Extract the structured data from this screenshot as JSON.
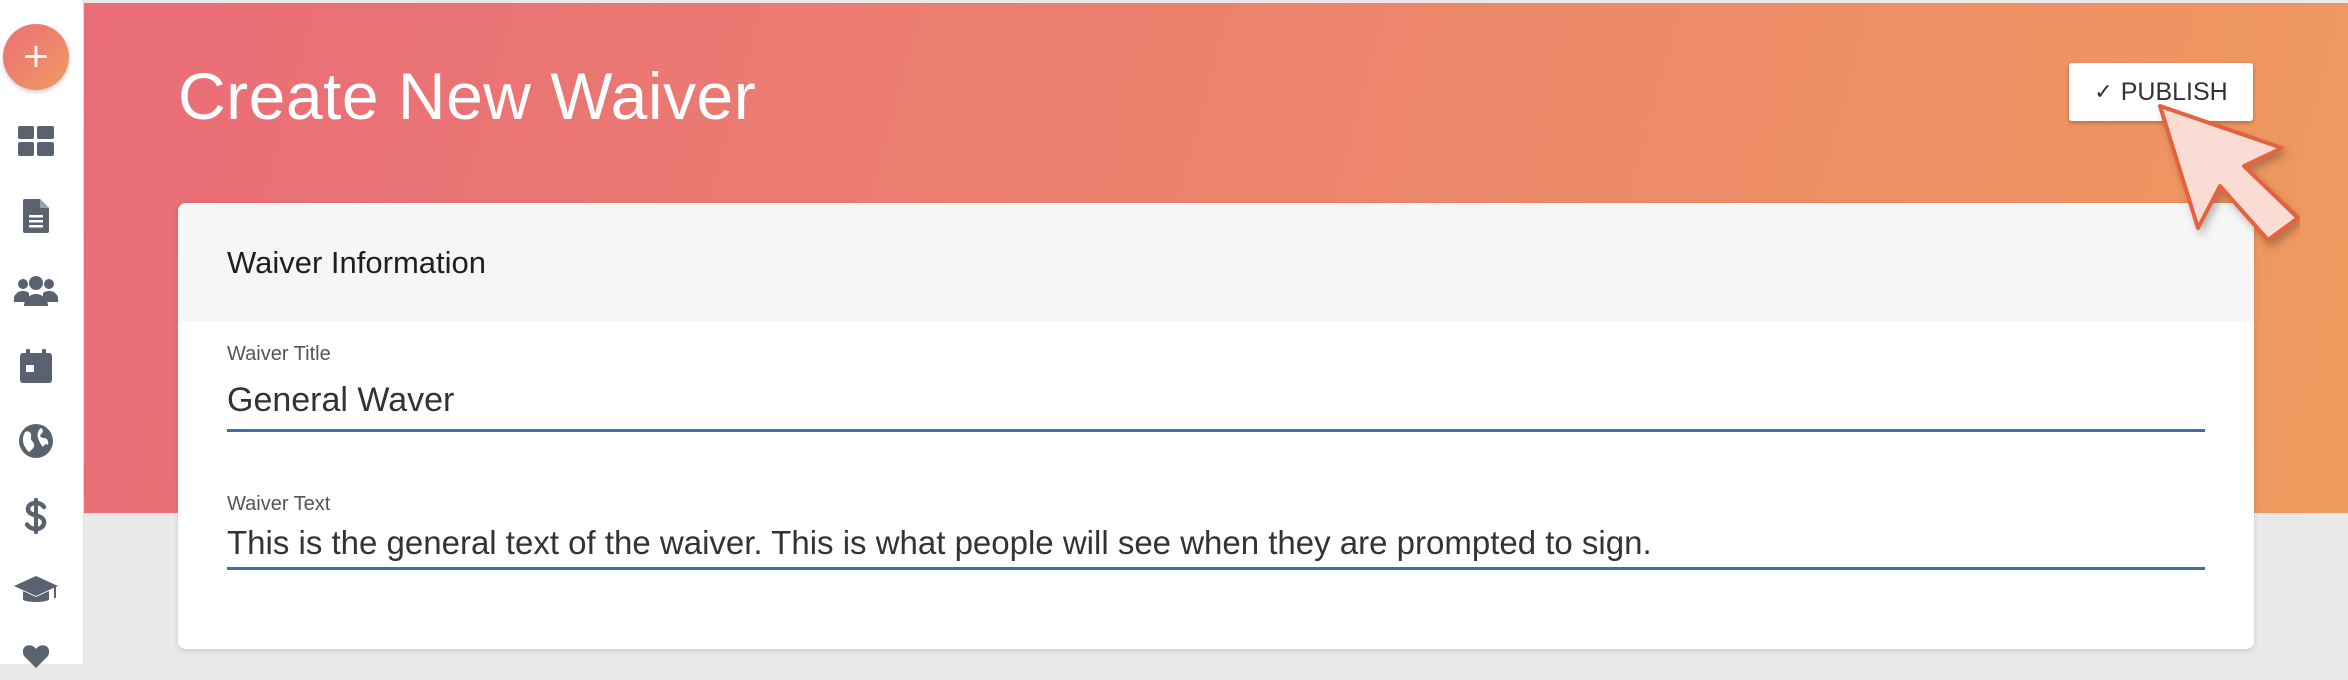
{
  "app": {
    "fab_label": "+",
    "accent_gradient": [
      "#eb6e78",
      "#ef9a60"
    ]
  },
  "sidebar": {
    "items": [
      {
        "icon": "dashboard-icon"
      },
      {
        "icon": "document-icon"
      },
      {
        "icon": "users-icon"
      },
      {
        "icon": "calendar-icon"
      },
      {
        "icon": "globe-icon"
      },
      {
        "icon": "dollar-icon"
      },
      {
        "icon": "graduation-cap-icon"
      },
      {
        "icon": "heart-icon"
      }
    ]
  },
  "header": {
    "title": "Create New Waiver",
    "publish_label": "PUBLISH",
    "publish_icon": "check-icon"
  },
  "card": {
    "title": "Waiver Information",
    "fields": {
      "title_label": "Waiver Title",
      "title_value": "General Waver",
      "text_label": "Waiver Text",
      "text_value": "This is the general text of the waiver. This is what people will see when they are prompted to sign."
    }
  },
  "colors": {
    "input_underline": "#3a6fb7",
    "icon_gray": "#5a6270"
  }
}
